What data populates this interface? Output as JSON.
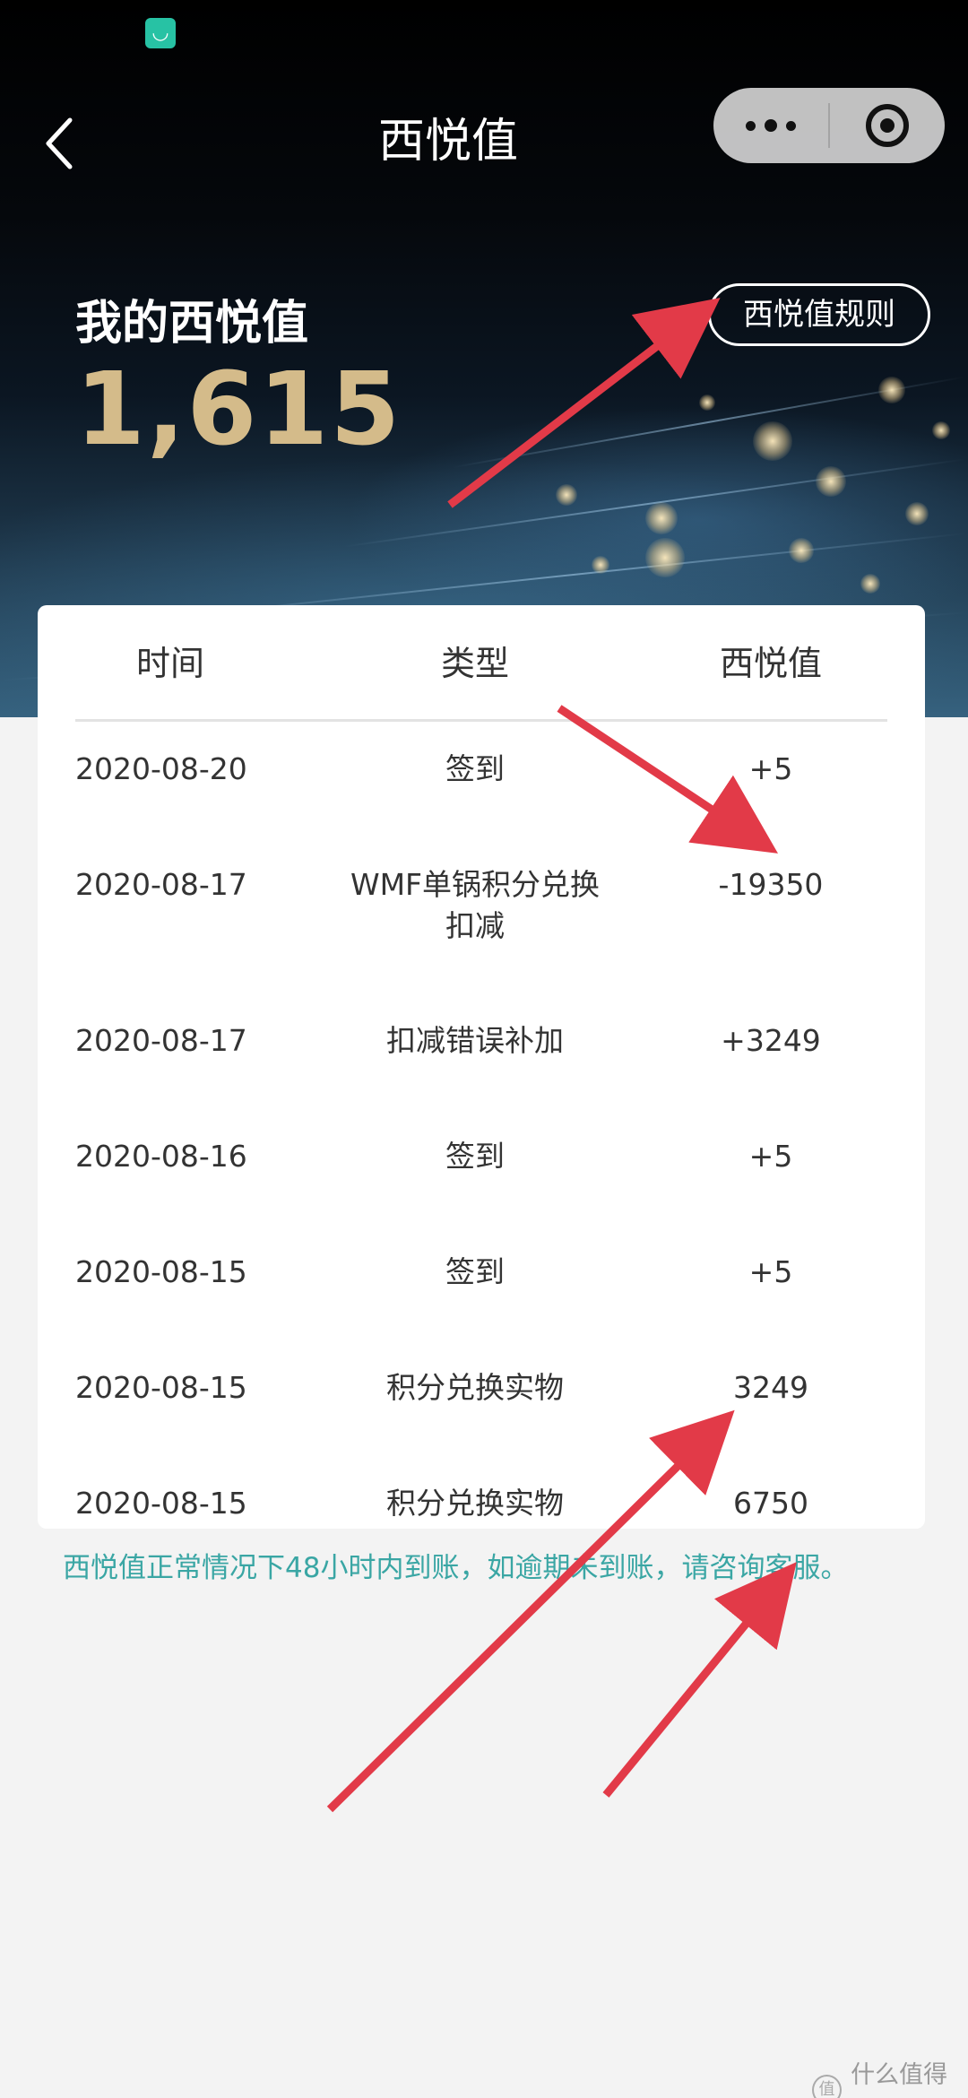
{
  "status_bar": {
    "app_icon": "mi-icon"
  },
  "nav": {
    "title": "西悦值",
    "back_icon": "chevron-left-icon",
    "more_icon": "more-dots-icon",
    "close_icon": "target-circle-icon"
  },
  "header": {
    "my_label": "我的西悦值",
    "my_value": "1,615",
    "rules_button": "西悦值规则"
  },
  "table": {
    "columns": [
      "时间",
      "类型",
      "西悦值"
    ],
    "rows": [
      {
        "date": "2020-08-20",
        "type": "签到",
        "value": "+5"
      },
      {
        "date": "2020-08-17",
        "type": "WMF单锅积分兑换扣减",
        "value": "-19350"
      },
      {
        "date": "2020-08-17",
        "type": "扣减错误补加",
        "value": "+3249"
      },
      {
        "date": "2020-08-16",
        "type": "签到",
        "value": "+5"
      },
      {
        "date": "2020-08-15",
        "type": "签到",
        "value": "+5"
      },
      {
        "date": "2020-08-15",
        "type": "积分兑换实物",
        "value": "3249"
      },
      {
        "date": "2020-08-15",
        "type": "积分兑换实物",
        "value": "6750"
      }
    ]
  },
  "footer_note": "西悦值正常情况下48小时内到账，如逾期未到账，请咨询客服。",
  "watermark": "什么值得买",
  "colors": {
    "accent_gold": "#d4bb8a",
    "note_teal": "#3aa6a4",
    "arrow_red": "#e23a48"
  }
}
